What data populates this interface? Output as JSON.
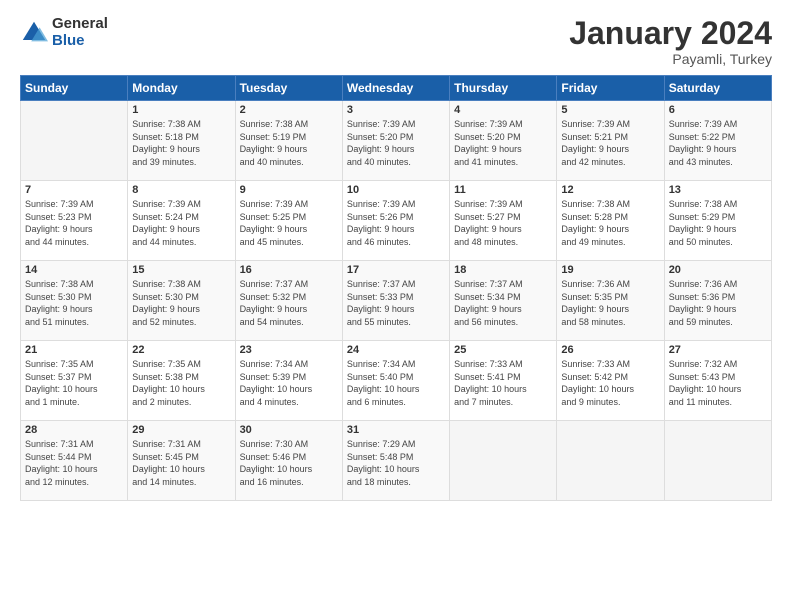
{
  "logo": {
    "general": "General",
    "blue": "Blue"
  },
  "title": "January 2024",
  "subtitle": "Payamli, Turkey",
  "days_header": [
    "Sunday",
    "Monday",
    "Tuesday",
    "Wednesday",
    "Thursday",
    "Friday",
    "Saturday"
  ],
  "weeks": [
    [
      {
        "day": "",
        "lines": []
      },
      {
        "day": "1",
        "lines": [
          "Sunrise: 7:38 AM",
          "Sunset: 5:18 PM",
          "Daylight: 9 hours",
          "and 39 minutes."
        ]
      },
      {
        "day": "2",
        "lines": [
          "Sunrise: 7:38 AM",
          "Sunset: 5:19 PM",
          "Daylight: 9 hours",
          "and 40 minutes."
        ]
      },
      {
        "day": "3",
        "lines": [
          "Sunrise: 7:39 AM",
          "Sunset: 5:20 PM",
          "Daylight: 9 hours",
          "and 40 minutes."
        ]
      },
      {
        "day": "4",
        "lines": [
          "Sunrise: 7:39 AM",
          "Sunset: 5:20 PM",
          "Daylight: 9 hours",
          "and 41 minutes."
        ]
      },
      {
        "day": "5",
        "lines": [
          "Sunrise: 7:39 AM",
          "Sunset: 5:21 PM",
          "Daylight: 9 hours",
          "and 42 minutes."
        ]
      },
      {
        "day": "6",
        "lines": [
          "Sunrise: 7:39 AM",
          "Sunset: 5:22 PM",
          "Daylight: 9 hours",
          "and 43 minutes."
        ]
      }
    ],
    [
      {
        "day": "7",
        "lines": [
          "Sunrise: 7:39 AM",
          "Sunset: 5:23 PM",
          "Daylight: 9 hours",
          "and 44 minutes."
        ]
      },
      {
        "day": "8",
        "lines": [
          "Sunrise: 7:39 AM",
          "Sunset: 5:24 PM",
          "Daylight: 9 hours",
          "and 44 minutes."
        ]
      },
      {
        "day": "9",
        "lines": [
          "Sunrise: 7:39 AM",
          "Sunset: 5:25 PM",
          "Daylight: 9 hours",
          "and 45 minutes."
        ]
      },
      {
        "day": "10",
        "lines": [
          "Sunrise: 7:39 AM",
          "Sunset: 5:26 PM",
          "Daylight: 9 hours",
          "and 46 minutes."
        ]
      },
      {
        "day": "11",
        "lines": [
          "Sunrise: 7:39 AM",
          "Sunset: 5:27 PM",
          "Daylight: 9 hours",
          "and 48 minutes."
        ]
      },
      {
        "day": "12",
        "lines": [
          "Sunrise: 7:38 AM",
          "Sunset: 5:28 PM",
          "Daylight: 9 hours",
          "and 49 minutes."
        ]
      },
      {
        "day": "13",
        "lines": [
          "Sunrise: 7:38 AM",
          "Sunset: 5:29 PM",
          "Daylight: 9 hours",
          "and 50 minutes."
        ]
      }
    ],
    [
      {
        "day": "14",
        "lines": [
          "Sunrise: 7:38 AM",
          "Sunset: 5:30 PM",
          "Daylight: 9 hours",
          "and 51 minutes."
        ]
      },
      {
        "day": "15",
        "lines": [
          "Sunrise: 7:38 AM",
          "Sunset: 5:30 PM",
          "Daylight: 9 hours",
          "and 52 minutes."
        ]
      },
      {
        "day": "16",
        "lines": [
          "Sunrise: 7:37 AM",
          "Sunset: 5:32 PM",
          "Daylight: 9 hours",
          "and 54 minutes."
        ]
      },
      {
        "day": "17",
        "lines": [
          "Sunrise: 7:37 AM",
          "Sunset: 5:33 PM",
          "Daylight: 9 hours",
          "and 55 minutes."
        ]
      },
      {
        "day": "18",
        "lines": [
          "Sunrise: 7:37 AM",
          "Sunset: 5:34 PM",
          "Daylight: 9 hours",
          "and 56 minutes."
        ]
      },
      {
        "day": "19",
        "lines": [
          "Sunrise: 7:36 AM",
          "Sunset: 5:35 PM",
          "Daylight: 9 hours",
          "and 58 minutes."
        ]
      },
      {
        "day": "20",
        "lines": [
          "Sunrise: 7:36 AM",
          "Sunset: 5:36 PM",
          "Daylight: 9 hours",
          "and 59 minutes."
        ]
      }
    ],
    [
      {
        "day": "21",
        "lines": [
          "Sunrise: 7:35 AM",
          "Sunset: 5:37 PM",
          "Daylight: 10 hours",
          "and 1 minute."
        ]
      },
      {
        "day": "22",
        "lines": [
          "Sunrise: 7:35 AM",
          "Sunset: 5:38 PM",
          "Daylight: 10 hours",
          "and 2 minutes."
        ]
      },
      {
        "day": "23",
        "lines": [
          "Sunrise: 7:34 AM",
          "Sunset: 5:39 PM",
          "Daylight: 10 hours",
          "and 4 minutes."
        ]
      },
      {
        "day": "24",
        "lines": [
          "Sunrise: 7:34 AM",
          "Sunset: 5:40 PM",
          "Daylight: 10 hours",
          "and 6 minutes."
        ]
      },
      {
        "day": "25",
        "lines": [
          "Sunrise: 7:33 AM",
          "Sunset: 5:41 PM",
          "Daylight: 10 hours",
          "and 7 minutes."
        ]
      },
      {
        "day": "26",
        "lines": [
          "Sunrise: 7:33 AM",
          "Sunset: 5:42 PM",
          "Daylight: 10 hours",
          "and 9 minutes."
        ]
      },
      {
        "day": "27",
        "lines": [
          "Sunrise: 7:32 AM",
          "Sunset: 5:43 PM",
          "Daylight: 10 hours",
          "and 11 minutes."
        ]
      }
    ],
    [
      {
        "day": "28",
        "lines": [
          "Sunrise: 7:31 AM",
          "Sunset: 5:44 PM",
          "Daylight: 10 hours",
          "and 12 minutes."
        ]
      },
      {
        "day": "29",
        "lines": [
          "Sunrise: 7:31 AM",
          "Sunset: 5:45 PM",
          "Daylight: 10 hours",
          "and 14 minutes."
        ]
      },
      {
        "day": "30",
        "lines": [
          "Sunrise: 7:30 AM",
          "Sunset: 5:46 PM",
          "Daylight: 10 hours",
          "and 16 minutes."
        ]
      },
      {
        "day": "31",
        "lines": [
          "Sunrise: 7:29 AM",
          "Sunset: 5:48 PM",
          "Daylight: 10 hours",
          "and 18 minutes."
        ]
      },
      {
        "day": "",
        "lines": []
      },
      {
        "day": "",
        "lines": []
      },
      {
        "day": "",
        "lines": []
      }
    ]
  ]
}
